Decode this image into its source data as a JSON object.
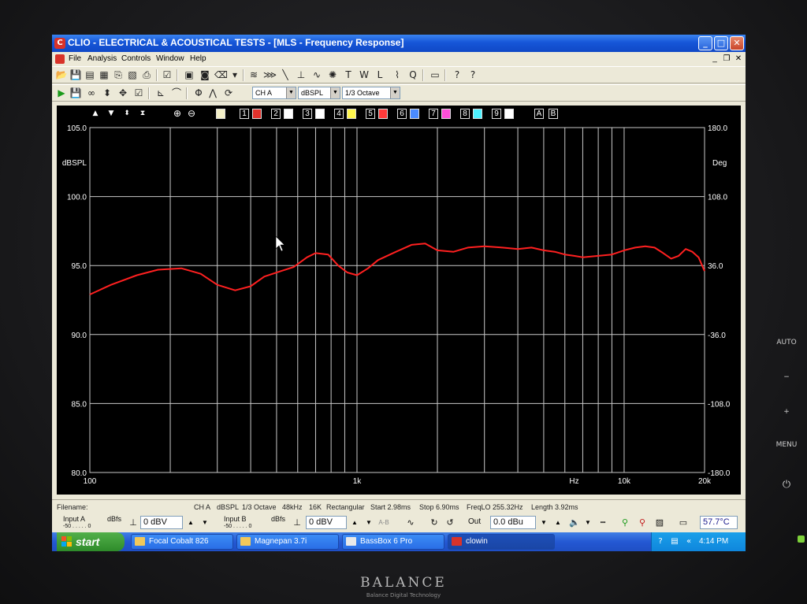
{
  "window": {
    "title": "CLIO - ELECTRICAL & ACOUSTICAL TESTS - [MLS - Frequency Response]",
    "app_icon_glyph": "C"
  },
  "menu": [
    "File",
    "Analysis",
    "Controls",
    "Window",
    "Help"
  ],
  "toolbar2": {
    "channel": "CH A",
    "units": "dBSPL",
    "smoothing": "1/3 Octave"
  },
  "trace_buttons": [
    {
      "num": "1",
      "color": "#e0312b"
    },
    {
      "num": "2",
      "color": "#ffffff"
    },
    {
      "num": "3",
      "color": "#ffffff"
    },
    {
      "num": "4",
      "color": "#fff64d"
    },
    {
      "num": "5",
      "color": "#ff3a3a"
    },
    {
      "num": "6",
      "color": "#4b8bff"
    },
    {
      "num": "7",
      "color": "#ff4fd8"
    },
    {
      "num": "8",
      "color": "#4ef2ff"
    },
    {
      "num": "9",
      "color": "#ffffff"
    }
  ],
  "ab_buttons": [
    "A",
    "B"
  ],
  "chart_data": {
    "type": "line",
    "title": "",
    "xlabel": "Hz",
    "ylabel": "dBSPL",
    "y2label": "Deg",
    "xscale": "log",
    "xlim": [
      100,
      20000
    ],
    "ylim": [
      80,
      105
    ],
    "y2lim": [
      -180,
      180
    ],
    "x_tick_labels": [
      "100",
      "1k",
      "10k",
      "20k"
    ],
    "y_tick_labels": [
      "105.0",
      "100.0",
      "95.0",
      "90.0",
      "85.0",
      "80.0"
    ],
    "y2_tick_labels": [
      "180.0",
      "108.0",
      "36.0",
      "-36.0",
      "-108.0",
      "-180.0"
    ],
    "grid": true,
    "background": "#000000",
    "grid_color": "#c8c8c8",
    "series": [
      {
        "color": "#ff2020",
        "x": [
          100,
          120,
          150,
          180,
          220,
          260,
          300,
          350,
          400,
          450,
          520,
          580,
          650,
          700,
          780,
          850,
          920,
          1000,
          1100,
          1200,
          1400,
          1600,
          1800,
          2000,
          2300,
          2600,
          3000,
          3500,
          4000,
          4500,
          5000,
          5500,
          6000,
          6500,
          7000,
          8000,
          9000,
          10000,
          11000,
          12000,
          13000,
          14000,
          15000,
          16000,
          17000,
          18000,
          19000,
          20000
        ],
        "y": [
          92.9,
          93.6,
          94.3,
          94.7,
          94.8,
          94.4,
          93.6,
          93.2,
          93.5,
          94.2,
          94.6,
          94.9,
          95.6,
          95.9,
          95.8,
          95.0,
          94.5,
          94.3,
          94.8,
          95.4,
          96.0,
          96.5,
          96.6,
          96.1,
          96.0,
          96.3,
          96.4,
          96.3,
          96.2,
          96.3,
          96.1,
          96.0,
          95.8,
          95.7,
          95.6,
          95.7,
          95.8,
          96.1,
          96.3,
          96.4,
          96.3,
          95.9,
          95.5,
          95.7,
          96.2,
          96.0,
          95.6,
          94.6
        ]
      }
    ]
  },
  "info_bar": {
    "filename_label": "Filename:",
    "channel": "CH A",
    "units": "dBSPL",
    "smoothing": "1/3 Octave",
    "rate": "48kHz",
    "size": "16K",
    "window": "Rectangular",
    "start": "Start 2.98ms",
    "stop": "Stop 6.90ms",
    "freqlo": "FreqLO 255.32Hz",
    "length": "Length 3.92ms"
  },
  "io_bar": {
    "input_a_label": "Input A",
    "input_a_scale": "-50 . . . . . 0",
    "input_a_dbfs": "dBfs",
    "input_a_value": "0 dBV",
    "input_b_label": "Input B",
    "input_b_scale": "-50 . . . . . 0",
    "input_b_dbfs": "dBfs",
    "input_b_value": "0 dBV",
    "out_label": "Out",
    "out_value": "0.0 dBu",
    "temperature": "57.7°C"
  },
  "taskbar": {
    "start_label": "start",
    "tasks": [
      "Focal Cobalt 826",
      "Magnepan 3.7i",
      "BassBox 6 Pro",
      "clowin"
    ],
    "clock": "4:14 PM"
  },
  "bezel": {
    "brand": "BALANCE",
    "brand_sub": "Balance Digital Technology",
    "auto_label": "AUTO",
    "minus_label": "−",
    "plus_label": "+",
    "menu_label": "MENU",
    "power_glyph": "⏻"
  }
}
